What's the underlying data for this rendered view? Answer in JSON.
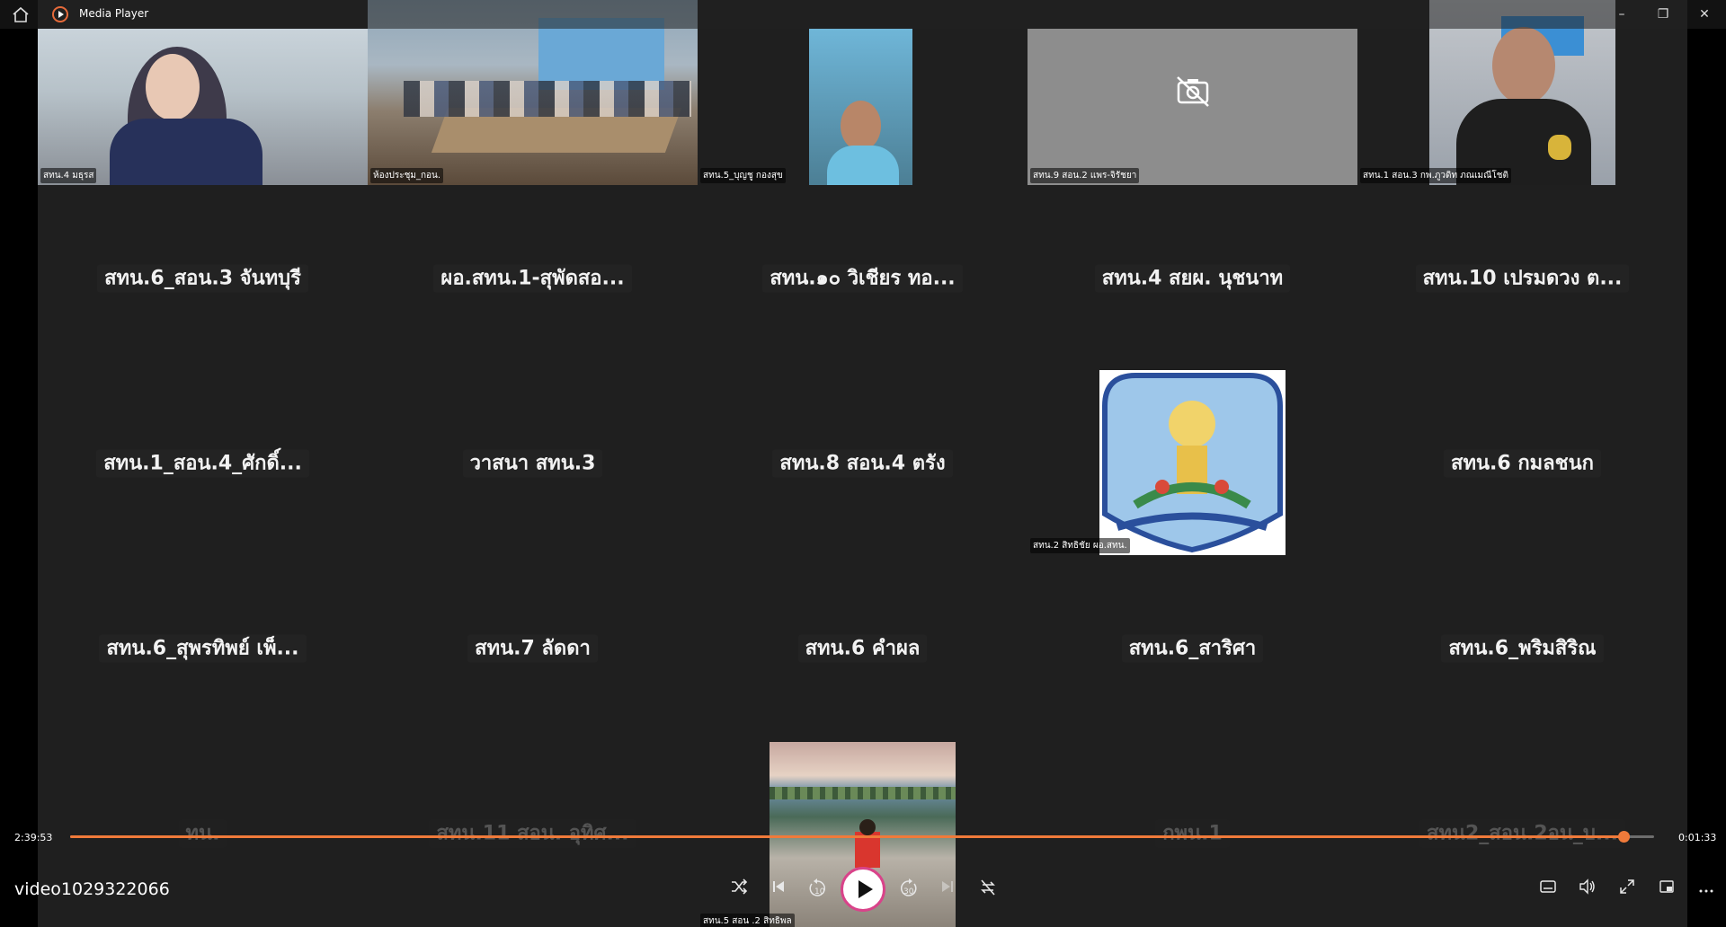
{
  "window": {
    "app_title": "Media Player",
    "minimize": "–",
    "restore": "❐",
    "close": "✕"
  },
  "grid": {
    "row1": [
      {
        "caption": "สทน.4 มธุรส"
      },
      {
        "caption": "ห้องประชุม_กอน."
      },
      {
        "caption": "สทน.5_บุญชู กองสุข"
      },
      {
        "caption": "สทน.9 สอน.2 แพร-จิรัชยา"
      },
      {
        "caption": "สทน.1 สอน.3 กพ.ภูวดิท ภณเมณีโชติ"
      }
    ],
    "row2": [
      {
        "name": "สทน.6_สอน.3 จันทบุรี"
      },
      {
        "name": "ผอ.สทน.1-สุพัดสอ..."
      },
      {
        "name": "สทน.๑๐ วิเชียร ทอ..."
      },
      {
        "name": "สทน.4 สยผ. นุชนาท"
      },
      {
        "name": "สทน.10 เปรมดวง ต..."
      }
    ],
    "row3": [
      {
        "name": "สทน.1_สอน.4_ศักดิ์..."
      },
      {
        "name": "วาสนา สทน.3"
      },
      {
        "name": "สทน.8 สอน.4 ตรัง"
      },
      {
        "name": "",
        "caption": "สทน.2 สิทธิชัย ผอ.สทน."
      },
      {
        "name": "สทน.6 กมลชนก"
      }
    ],
    "row4": [
      {
        "name": "สทน.6_สุพรทิพย์ เพ็..."
      },
      {
        "name": "สทน.7 ลัดดา"
      },
      {
        "name": "สทน.6 คำผล"
      },
      {
        "name": "สทน.6_สาริศา"
      },
      {
        "name": "สทน.6_พริมสิริณ"
      }
    ],
    "row5": [
      {
        "name": "ทน."
      },
      {
        "name": "สทน.11 สอน. อุทิศ..."
      },
      {
        "name": "",
        "caption": "สทน.5 สอน .2 สิทธิพล"
      },
      {
        "name": "กพน.1"
      },
      {
        "name": "สทน2_สอน.2อน_บ..."
      }
    ]
  },
  "player": {
    "elapsed": "2:39:53",
    "remaining": "0:01:33",
    "progress": 0.9805,
    "file_title": "video1029322066",
    "skip_back_label": "10",
    "skip_fwd_label": "30",
    "accent": "#f07a3a"
  }
}
